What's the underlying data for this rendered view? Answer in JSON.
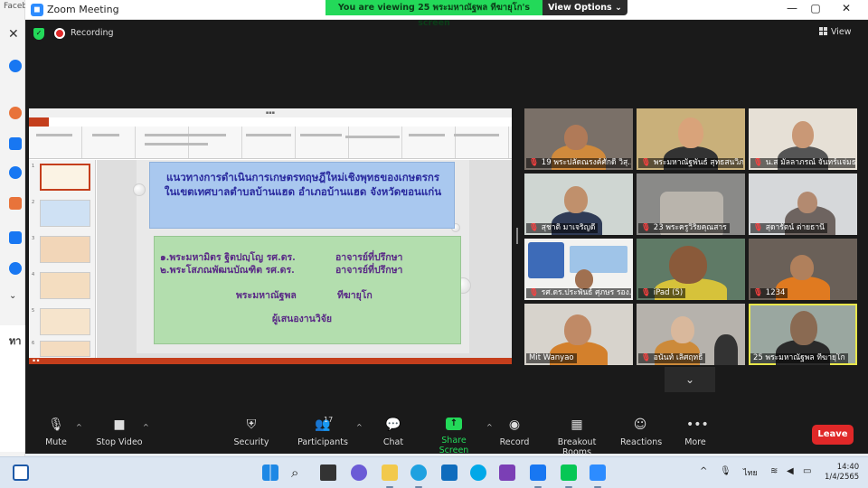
{
  "background_window": {
    "tab_text": "Faceb",
    "side_text": "ทา"
  },
  "window": {
    "title": "Zoom Meeting",
    "share_banner": "You are viewing 25  พระมหาณัฐพล  ทีฆายุโก's screen",
    "view_options": "View Options ⌄"
  },
  "meeting": {
    "recording_label": "Recording",
    "view_label": "View"
  },
  "slide": {
    "title_line1": "แนวทางการดำเนินการเกษตรทฤษฎีใหม่เชิงพุทธของเกษตรกร",
    "title_line2": "ในเขตเทศบาลตำบลบ้านแฮด อำเภอบ้านแฮด จังหวัดขอนแก่น",
    "advisor1_name": "๑.พระมหามิตร  ฐิตปญฺโญ  รศ.ดร.",
    "advisor1_role": "อาจารย์ที่ปรึกษา",
    "advisor2_name": "๒.พระโสภณพัฒนบัณฑิต รศ.ดร.",
    "advisor2_role": "อาจารย์ที่ปรึกษา",
    "presenter_name": "พระมหาณัฐพล",
    "presenter_surname": "ทีฆายุโก",
    "presenter_role": "ผู้เสนองานวิจัย",
    "thumb_numbers": [
      "1",
      "2",
      "3",
      "4",
      "5",
      "6"
    ]
  },
  "participants": [
    {
      "name": "19 พระปลัดณรงค์ศักดิ์ วิสุ...",
      "muted": true
    },
    {
      "name": "พระมหาณัฐพันธ์ สุทธสนวิภา...",
      "muted": true
    },
    {
      "name": "น.ส มัลลาภรณ์ จันทร์แจ่มธ...",
      "muted": true
    },
    {
      "name": "สุชาติ มาเจริญดี",
      "muted": true
    },
    {
      "name": "23  พระครูวิริยคุณสาร",
      "muted": true
    },
    {
      "name": "สุดารัตน์ ต่ายธานี",
      "muted": true
    },
    {
      "name": "รศ.ดร.ประพันธ์ ศุภษร รอง...",
      "muted": true
    },
    {
      "name": "iPad (5)",
      "muted": true
    },
    {
      "name": "1234",
      "muted": true
    },
    {
      "name": "Mit Wanyao",
      "muted": false
    },
    {
      "name": "อนันท์ เลิศฤทธิ์",
      "muted": true
    },
    {
      "name": "25  พระมหาณัฐพล  ทีฆายุโก",
      "muted": false
    }
  ],
  "toolbar": {
    "mute": "Mute",
    "stop_video": "Stop Video",
    "security": "Security",
    "participants": "Participants",
    "participant_count": "17",
    "chat": "Chat",
    "share_screen": "Share Screen",
    "record": "Record",
    "breakout_rooms": "Breakout Rooms",
    "reactions": "Reactions",
    "more": "More",
    "leave": "Leave"
  },
  "taskbar": {
    "language": "ไทย",
    "time": "14:40",
    "date": "1/4/2565"
  },
  "colors": {
    "share_green": "#23d959",
    "leave_red": "#e02828",
    "active_speaker": "#e8e64a",
    "ppt_accent": "#c43e1c"
  }
}
